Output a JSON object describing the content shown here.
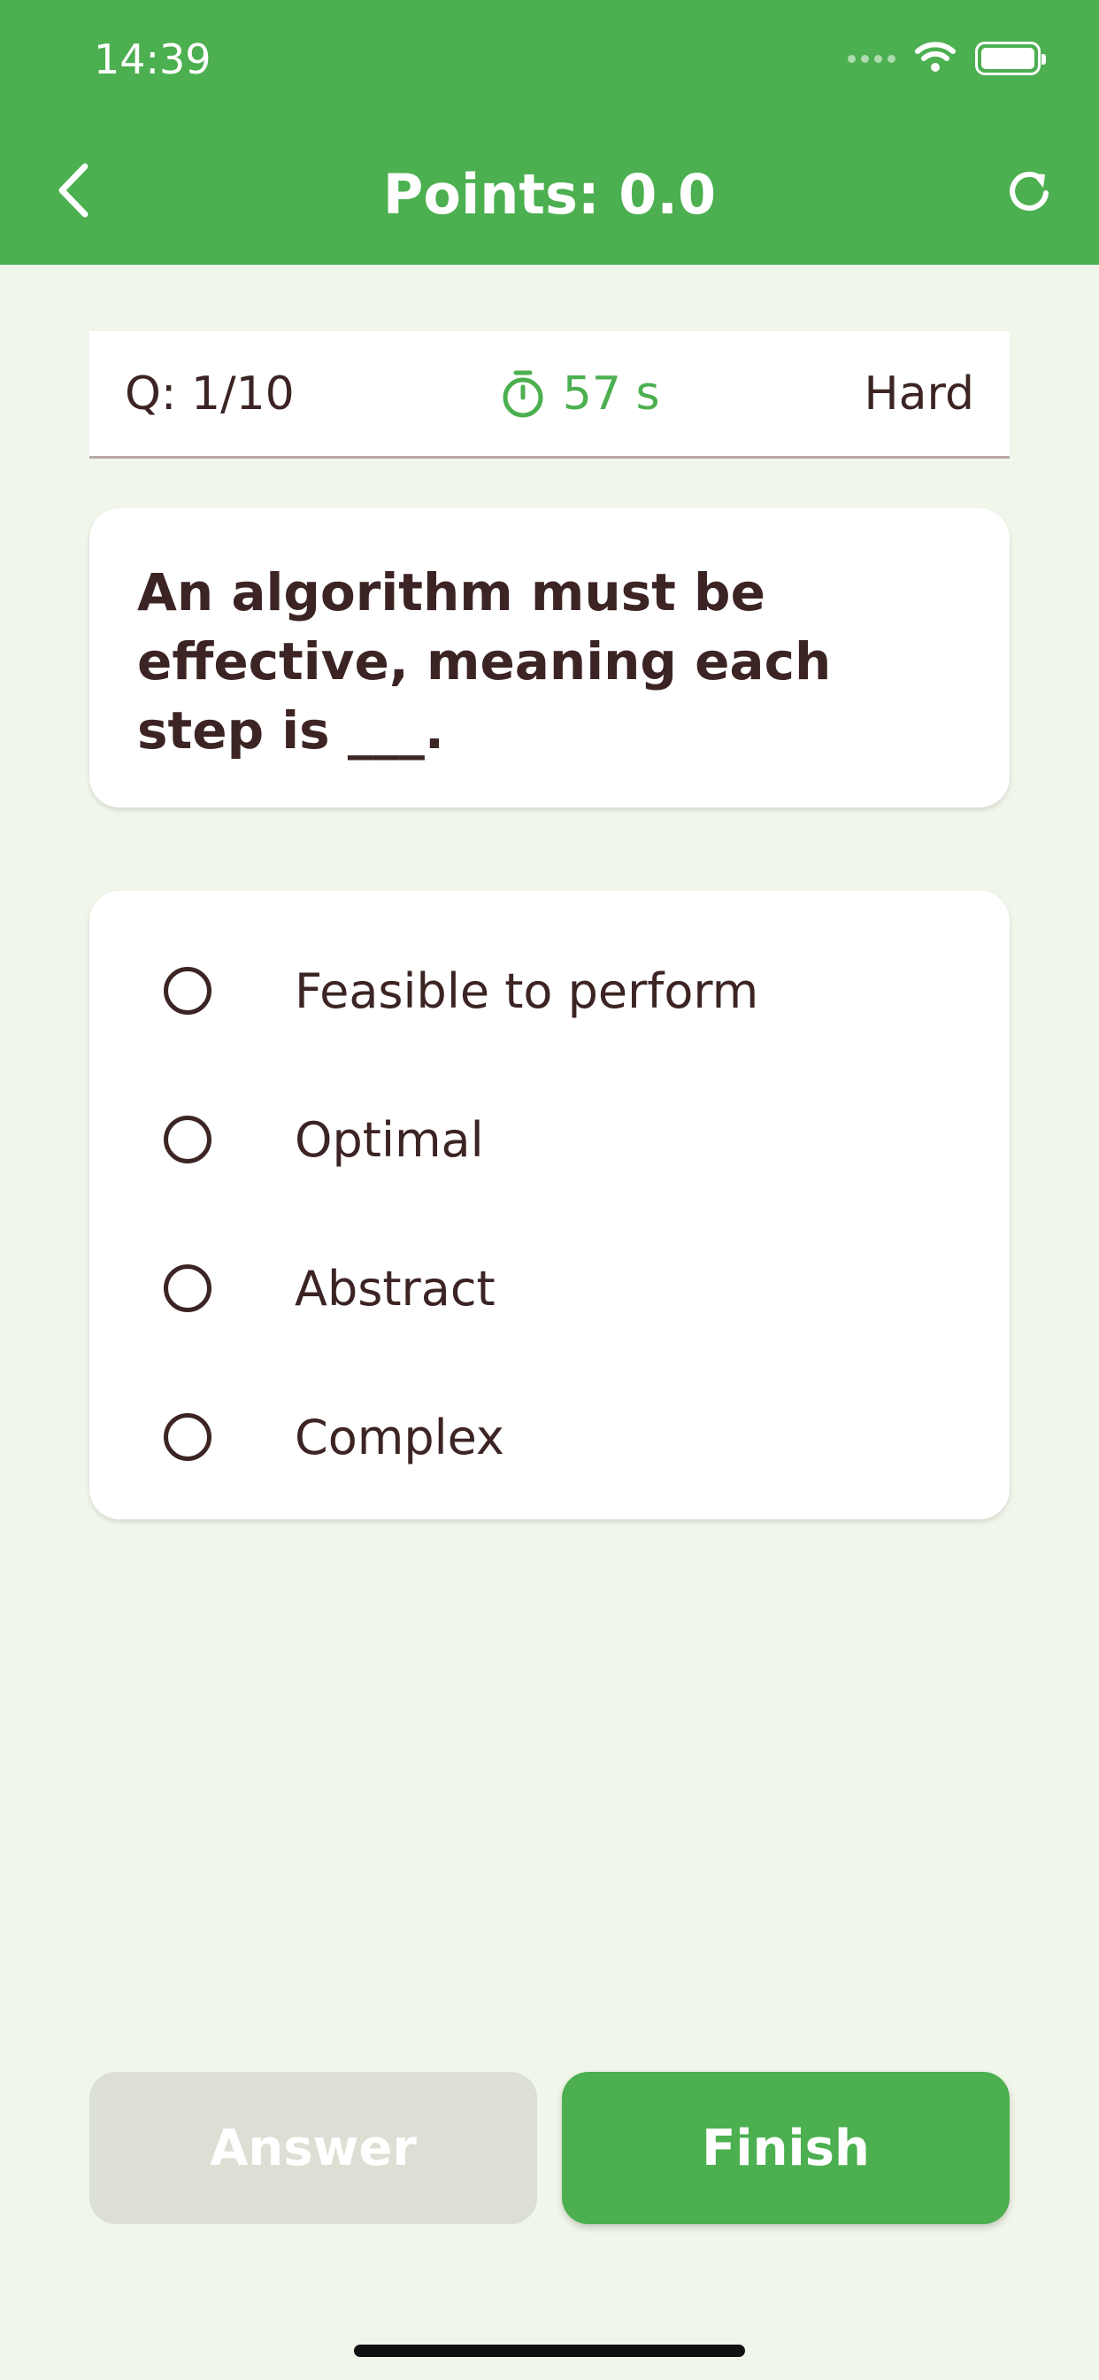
{
  "status_bar": {
    "time": "14:39"
  },
  "nav": {
    "title": "Points: 0.0"
  },
  "info": {
    "question_counter": "Q: 1/10",
    "timer": "57 s",
    "difficulty": "Hard"
  },
  "question": {
    "text": "An algorithm must be effective, meaning each step is ___."
  },
  "options": [
    {
      "label": "Feasible to perform",
      "selected": false
    },
    {
      "label": "Optimal",
      "selected": false
    },
    {
      "label": "Abstract",
      "selected": false
    },
    {
      "label": "Complex",
      "selected": false
    }
  ],
  "buttons": {
    "answer_label": "Answer",
    "answer_enabled": false,
    "finish_label": "Finish"
  },
  "colors": {
    "primary": "#4caf50",
    "background": "#f1f6ea",
    "text": "#3d2424",
    "disabled": "#dcdfd3"
  },
  "icons": {
    "back": "chevron-left-icon",
    "refresh": "refresh-icon",
    "timer": "stopwatch-icon",
    "wifi": "wifi-icon",
    "battery": "battery-icon"
  }
}
